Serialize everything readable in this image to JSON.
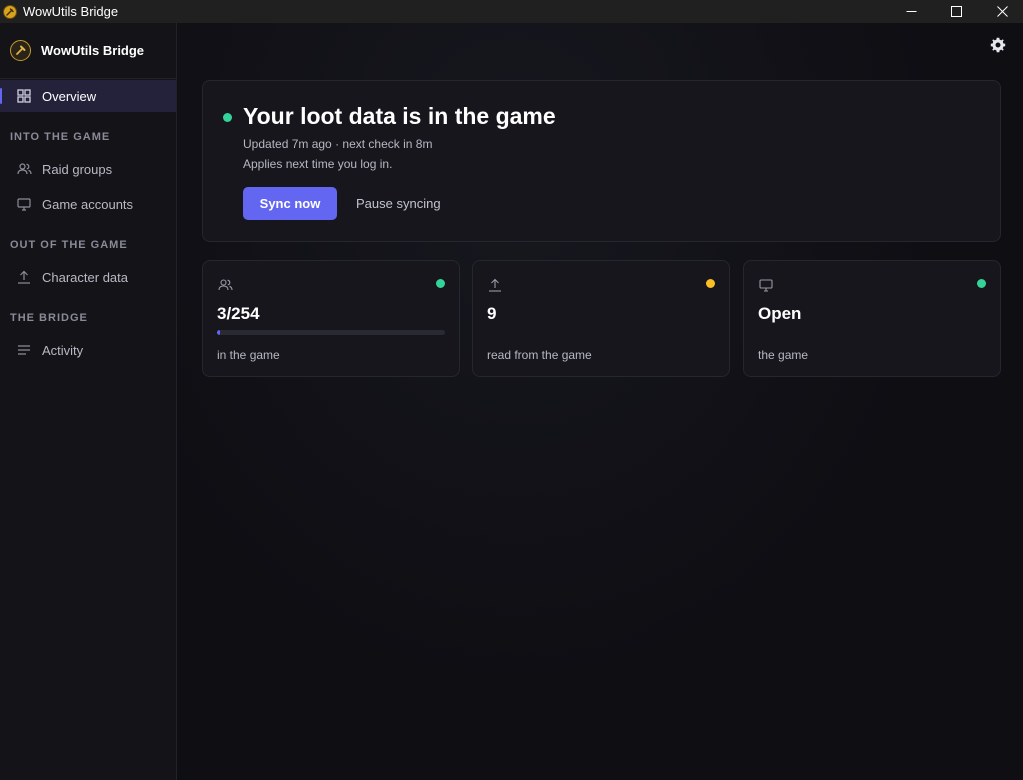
{
  "window": {
    "title": "WowUtils Bridge",
    "controls": [
      "minimize-icon",
      "maximize-icon",
      "close-icon"
    ]
  },
  "sidebar": {
    "brand": "WowUtils Bridge",
    "overview": {
      "label": "Overview",
      "icon": "grid-icon",
      "active": true
    },
    "sections": [
      {
        "label": "INTO THE GAME",
        "items": [
          {
            "label": "Raid groups",
            "icon": "users-icon"
          },
          {
            "label": "Game accounts",
            "icon": "monitor-icon"
          }
        ]
      },
      {
        "label": "OUT OF THE GAME",
        "items": [
          {
            "label": "Character data",
            "icon": "upload-icon"
          }
        ]
      },
      {
        "label": "THE BRIDGE",
        "items": [
          {
            "label": "Activity",
            "icon": "list-icon"
          }
        ]
      }
    ]
  },
  "header": {
    "settings_icon": "gear-icon"
  },
  "hero": {
    "title": "Your loot data is in the game",
    "updated": "Updated 7m ago · next check in 8m",
    "note": "Applies next time you log in.",
    "sync_label": "Sync now",
    "pause_label": "Pause syncing",
    "status_color": "#34d399"
  },
  "cards": [
    {
      "icon": "users-icon",
      "value": "3/254",
      "label": "in the game",
      "status_color": "#34d399",
      "progress": 0.012
    },
    {
      "icon": "upload-icon",
      "value": "9",
      "label": "read from the game",
      "status_color": "#fbbf24"
    },
    {
      "icon": "monitor-icon",
      "value": "Open",
      "label": "the game",
      "status_color": "#34d399"
    }
  ],
  "colors": {
    "accent": "#6366f1",
    "ok": "#34d399",
    "warn": "#fbbf24"
  }
}
